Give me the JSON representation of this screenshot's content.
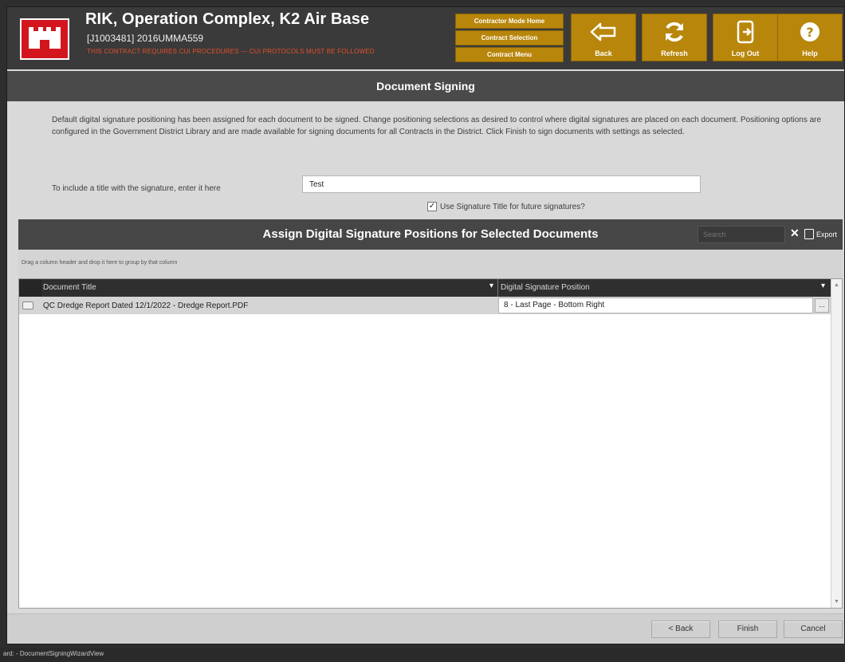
{
  "header": {
    "title": "RIK, Operation Complex, K2 Air Base",
    "subtitle": "[J1003481] 2016UMMA559",
    "warning": "THIS CONTRACT REQUIRES CUI PROCEDURES — CUI PROTOCOLS MUST BE FOLLOWED",
    "nav": {
      "home": "Contractor Mode Home",
      "contract_selection": "Contract Selection",
      "contract_menu": "Contract Menu"
    },
    "toolbar": {
      "back": "Back",
      "refresh": "Refresh",
      "logout": "Log Out",
      "help": "Help"
    },
    "colors": {
      "accent": "#b8860b",
      "logo_red": "#d3161d",
      "warning_text": "#e2502a"
    }
  },
  "page": {
    "title": "Document Signing",
    "description": "Default digital signature positioning has been assigned for each document to be signed. Change positioning selections as desired to control where digital signatures are placed on each document. Positioning options are configured in the Government District Library and are made available for signing documents for all Contracts in the District. Click Finish to sign documents with settings as selected.",
    "title_label": "To include a title with the signature, enter it here",
    "title_value": "Test",
    "use_title_label": "Use Signature Title for future signatures?",
    "use_title_checked": true
  },
  "grid": {
    "heading": "Assign Digital Signature Positions for Selected Documents",
    "search_placeholder": "Search",
    "export_label": "Export",
    "group_hint": "Drag a column header and drop it here to group by that column",
    "columns": [
      "Document Title",
      "Digital Signature Position"
    ],
    "rows": [
      {
        "title": "QC Dredge Report Dated 12/1/2022 - Dredge Report.PDF",
        "position": "8 - Last Page - Bottom Right",
        "ellipsis": "..."
      }
    ]
  },
  "footer": {
    "back": "< Back",
    "finish": "Finish",
    "cancel": "Cancel"
  },
  "status_bar": "ard: - DocumentSigningWizardView"
}
